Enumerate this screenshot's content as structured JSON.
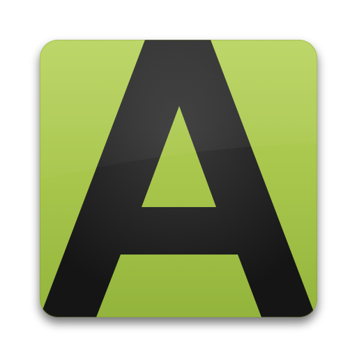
{
  "icon": {
    "glyph": "A",
    "background_color": "#a8c64c",
    "background_color_light": "#b6d25a",
    "background_color_dark": "#93b43c",
    "glyph_color": "#151515",
    "glyph_highlight_color": "#3a3a3a"
  }
}
